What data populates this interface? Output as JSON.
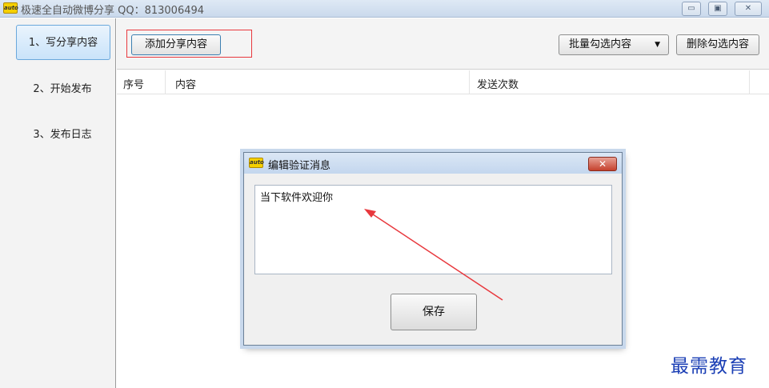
{
  "window": {
    "title": "极速全自动微博分享 QQ：813006494",
    "icon_label": "auto",
    "controls": {
      "minimize": "▭",
      "maximize": "▣",
      "close": "✕"
    }
  },
  "sidebar": {
    "items": [
      {
        "label": "1、写分享内容",
        "active": true
      },
      {
        "label": "2、开始发布",
        "active": false
      },
      {
        "label": "3、发布日志",
        "active": false
      }
    ]
  },
  "toolbar": {
    "add_label": "添加分享内容",
    "batch_label": "批量勾选内容",
    "batch_arrow": "▼",
    "delete_label": "删除勾选内容"
  },
  "table": {
    "columns": [
      "序号",
      "内容",
      "发送次数"
    ],
    "rows": []
  },
  "dialog": {
    "title": "编辑验证消息",
    "icon_label": "auto",
    "close_label": "✕",
    "message": "当下软件欢迎你",
    "save_label": "保存"
  },
  "watermark": "最需教育",
  "colors": {
    "highlight_box": "#e8383d",
    "annotation_arrow": "#e8383d",
    "watermark": "#1b3fb5",
    "active_nav": "#c9e3fa"
  }
}
